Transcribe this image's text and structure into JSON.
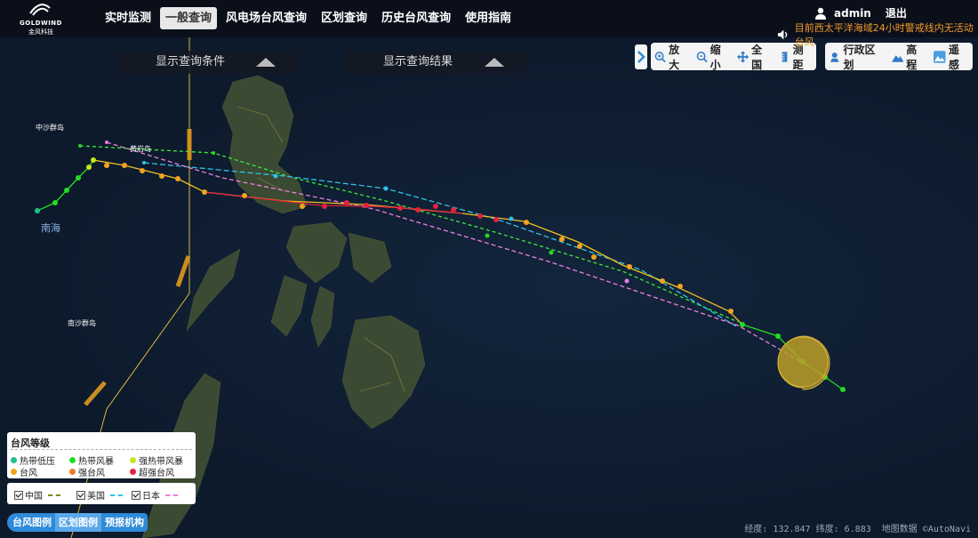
{
  "logo": {
    "brand": "GOLDWIND",
    "brand_cn": "金风科技"
  },
  "nav": {
    "items": [
      {
        "label": "实时监测",
        "active": false
      },
      {
        "label": "一般查询",
        "active": true
      },
      {
        "label": "风电场台风查询",
        "active": false
      },
      {
        "label": "区划查询",
        "active": false
      },
      {
        "label": "历史台风查询",
        "active": false
      },
      {
        "label": "使用指南",
        "active": false
      }
    ]
  },
  "user": {
    "name": "admin",
    "logout_label": "退出",
    "user_icon": "user-icon"
  },
  "alert": {
    "text": "目前西太平洋海域24小时警戒线内无活动台风",
    "color": "#f39a2b",
    "icon": "speaker-icon"
  },
  "query_panels": {
    "conditions_label": "显示查询条件",
    "results_label": "显示查询结果"
  },
  "toolbar": {
    "zoom_in": "放大",
    "zoom_out": "缩小",
    "full_extent": "全国",
    "measure": "测距",
    "admin_division": "行政区划",
    "elevation": "高程",
    "remote_sensing": "遥感"
  },
  "map_labels": {
    "zhongsha": "中沙群岛",
    "huangyan": "黄岩岛",
    "nanhai": "南海",
    "nansha": "南沙群岛"
  },
  "legend": {
    "title": "台风等级",
    "items": [
      {
        "label": "热带低压",
        "color": "#1fbf8f"
      },
      {
        "label": "热带风暴",
        "color": "#22dd22"
      },
      {
        "label": "强热带风暴",
        "color": "#c8e61e"
      },
      {
        "label": "台风",
        "color": "#f2a31f"
      },
      {
        "label": "强台风",
        "color": "#ee7a25"
      },
      {
        "label": "超强台风",
        "color": "#e82040"
      }
    ]
  },
  "agencies": [
    {
      "label": "中国",
      "color": "#7a8a1a"
    },
    {
      "label": "美国",
      "color": "#2fc3e8"
    },
    {
      "label": "日本",
      "color": "#ee7fe0"
    }
  ],
  "bottom_tabs": [
    "台风图例",
    "区划图例",
    "预报机构"
  ],
  "status": {
    "coords": "经度: 132.847 纬度: 6.883",
    "source": "地图数据 ©AutoNavi"
  }
}
